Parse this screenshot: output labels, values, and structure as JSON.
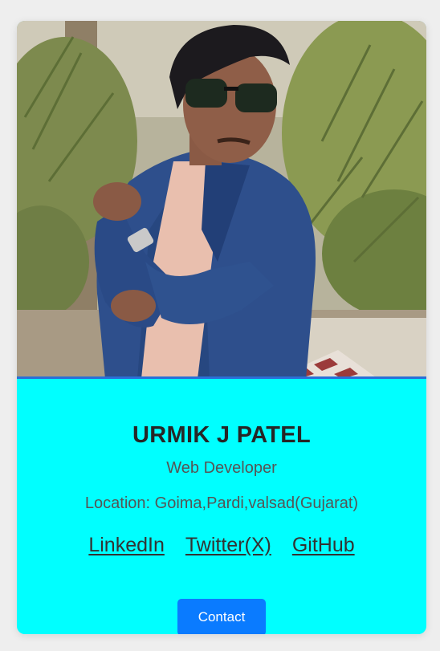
{
  "profile": {
    "name": "URMIK J PATEL",
    "role": "Web Developer",
    "location": "Location: Goima,Pardi,valsad(Gujarat)"
  },
  "links": [
    {
      "label": "LinkedIn"
    },
    {
      "label": "Twitter(X)"
    },
    {
      "label": "GitHub"
    }
  ],
  "contact_button": {
    "label": "Contact"
  },
  "colors": {
    "page_background": "#eeeeee",
    "card_info_background": "#00ffff",
    "button_background": "#0a7bff",
    "photo_border": "#2b6fd6"
  }
}
